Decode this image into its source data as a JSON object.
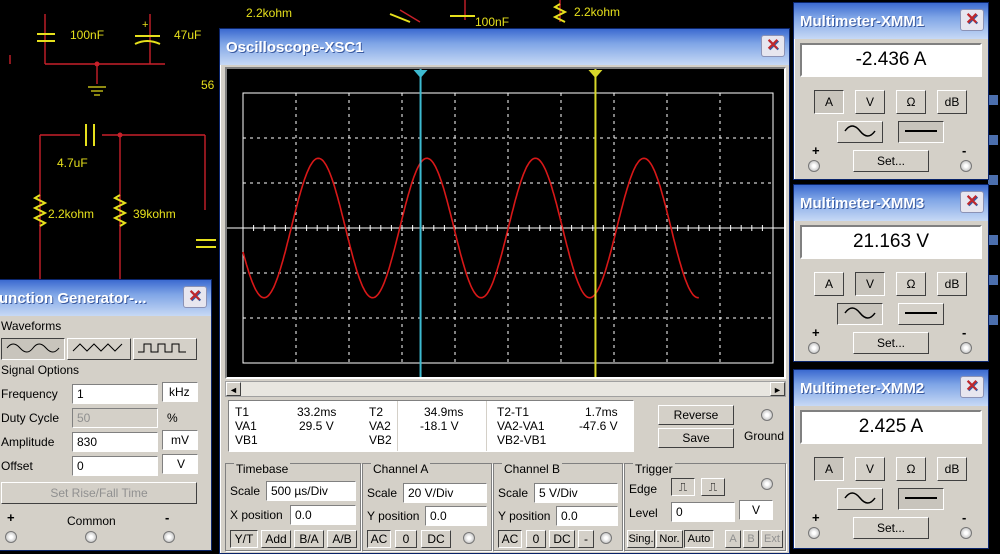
{
  "schematic": {
    "labels": [
      "2.2kohm",
      "100nF",
      "2.2kohm",
      "100nF",
      "47uF",
      "56",
      "4.7uF",
      "2.2kohm",
      "39kohm"
    ]
  },
  "oscilloscope": {
    "title": "Oscilloscope-XSC1",
    "close": "✕",
    "readout": {
      "t1": "T1",
      "t2": "T2",
      "t2t1": "T2-T1",
      "va1": "VA1",
      "vb1": "VB1",
      "va2": "VA2",
      "vb2": "VB2",
      "vdiff": "VA2-VA1",
      "vbdiff": "VB2-VB1",
      "t1_time": "33.2ms",
      "t1_va": "29.5 V",
      "t2_time": "34.9ms",
      "t2_va": "-18.1 V",
      "dt": "1.7ms",
      "dva": "-47.6 V"
    },
    "reverse": "Reverse",
    "save": "Save",
    "ground": "Ground",
    "timebase": {
      "title": "Timebase",
      "scale_label": "Scale",
      "scale": "500 µs/Div",
      "xpos_label": "X position",
      "xpos": "0.0",
      "yt": "Y/T",
      "add": "Add",
      "ba": "B/A",
      "ab": "A/B"
    },
    "channel_a": {
      "title": "Channel A",
      "scale_label": "Scale",
      "scale": "20 V/Div",
      "ypos_label": "Y position",
      "ypos": "0.0",
      "ac": "AC",
      "zero": "0",
      "dc": "DC"
    },
    "channel_b": {
      "title": "Channel B",
      "scale_label": "Scale",
      "scale": "5 V/Div",
      "ypos_label": "Y position",
      "ypos": "0.0",
      "ac": "AC",
      "zero": "0",
      "dc": "DC",
      "minus": "-"
    },
    "trigger": {
      "title": "Trigger",
      "edge_label": "Edge",
      "level_label": "Level",
      "level": "0",
      "unit": "V",
      "sing": "Sing.",
      "nor": "Nor.",
      "auto": "Auto",
      "a": "A",
      "b": "B",
      "ext": "Ext"
    },
    "colors": {
      "trace": "#d81818",
      "cursor1": "#3dbad0",
      "cursor2": "#d8d82a"
    },
    "signal": {
      "cycles_visible": 4.2,
      "amplitude_div": 1.55
    }
  },
  "function_generator": {
    "title": "Function Generator-...",
    "title_visible": "unction Generator-...",
    "close": "✕",
    "waveforms": "Waveforms",
    "signal_options": "Signal Options",
    "frequency_label": "Frequency",
    "frequency": "1",
    "frequency_unit": "kHz",
    "duty_label": "Duty Cycle",
    "duty": "50",
    "duty_unit": "%",
    "amplitude_label": "Amplitude",
    "amplitude": "830",
    "amplitude_unit": "mV",
    "offset_label": "Offset",
    "offset": "0",
    "offset_unit": "V",
    "rise_fall": "Set Rise/Fall Time",
    "plus": "+",
    "common": "Common",
    "minus": "-"
  },
  "multimeters": [
    {
      "title": "Multimeter-XMM1",
      "reading": "-2.436  A",
      "a": "A",
      "v": "V",
      "ohm": "Ω",
      "db": "dB",
      "set": "Set...",
      "plus": "+",
      "minus": "-",
      "mode": "A",
      "wave": "DC"
    },
    {
      "title": "Multimeter-XMM3",
      "reading": "21.163  V",
      "a": "A",
      "v": "V",
      "ohm": "Ω",
      "db": "dB",
      "set": "Set...",
      "plus": "+",
      "minus": "-",
      "mode": "V",
      "wave": "AC"
    },
    {
      "title": "Multimeter-XMM2",
      "reading": "2.425  A",
      "a": "A",
      "v": "V",
      "ohm": "Ω",
      "db": "dB",
      "set": "Set...",
      "plus": "+",
      "minus": "-",
      "mode": "A",
      "wave": "DC"
    }
  ]
}
